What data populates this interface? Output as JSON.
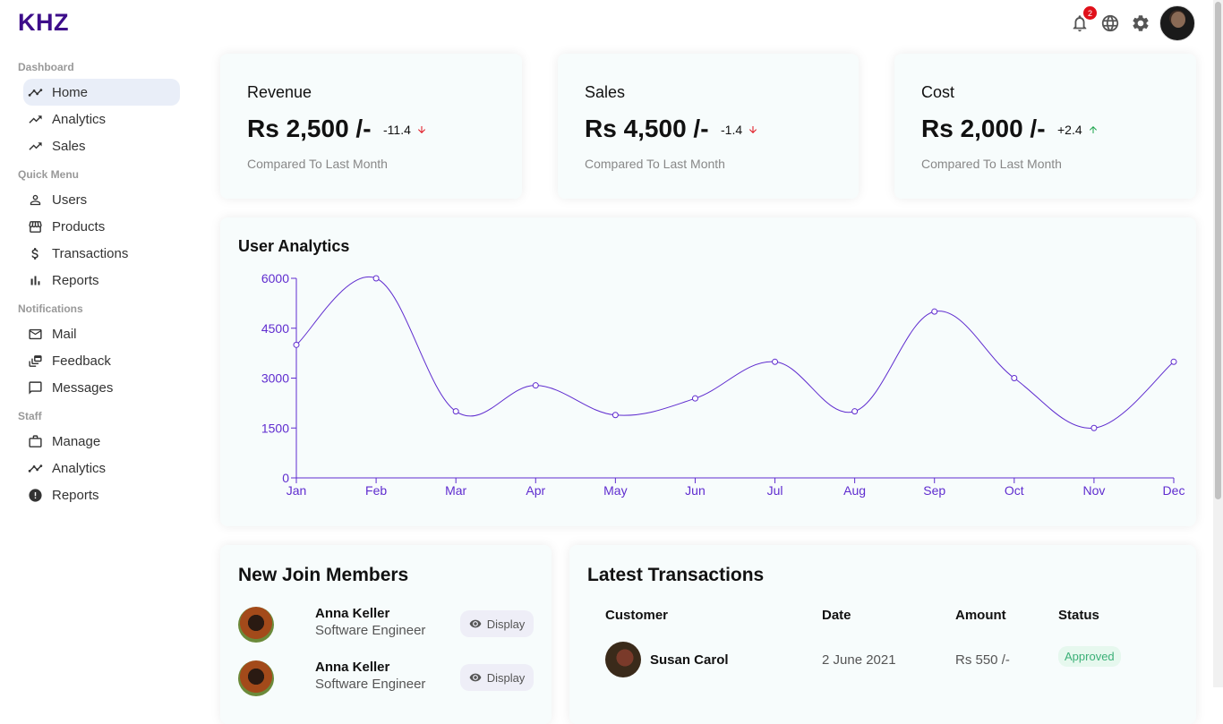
{
  "app": {
    "logo": "KHZ",
    "notification_count": "2"
  },
  "sidebar": {
    "sections": [
      {
        "title": "Dashboard",
        "items": [
          {
            "label": "Home",
            "icon": "timeline-icon",
            "active": true
          },
          {
            "label": "Analytics",
            "icon": "trending-up-icon"
          },
          {
            "label": "Sales",
            "icon": "trending-up-icon"
          }
        ]
      },
      {
        "title": "Quick Menu",
        "items": [
          {
            "label": "Users",
            "icon": "person-icon"
          },
          {
            "label": "Products",
            "icon": "storefront-icon"
          },
          {
            "label": "Transactions",
            "icon": "dollar-icon"
          },
          {
            "label": "Reports",
            "icon": "bar-chart-icon"
          }
        ]
      },
      {
        "title": "Notifications",
        "items": [
          {
            "label": "Mail",
            "icon": "mail-icon"
          },
          {
            "label": "Feedback",
            "icon": "dynamic-feed-icon"
          },
          {
            "label": "Messages",
            "icon": "chat-bubble-icon"
          }
        ]
      },
      {
        "title": "Staff",
        "items": [
          {
            "label": "Manage",
            "icon": "work-icon"
          },
          {
            "label": "Analytics",
            "icon": "timeline-icon"
          },
          {
            "label": "Reports",
            "icon": "report-icon"
          }
        ]
      }
    ]
  },
  "kpis": [
    {
      "title": "Revenue",
      "value": "Rs 2,500 /-",
      "rate": "-11.4",
      "trend": "down",
      "sub": "Compared To Last Month"
    },
    {
      "title": "Sales",
      "value": "Rs 4,500 /-",
      "rate": "-1.4",
      "trend": "down",
      "sub": "Compared To Last Month"
    },
    {
      "title": "Cost",
      "value": "Rs 2,000 /-",
      "rate": "+2.4",
      "trend": "up",
      "sub": "Compared To Last Month"
    }
  ],
  "colors": {
    "accent": "#5f2ccf",
    "down": "#e0101a",
    "up": "#1aa34a",
    "logo": "#3d0d8a"
  },
  "chart_data": {
    "type": "line",
    "title": "User Analytics",
    "categories": [
      "Jan",
      "Feb",
      "Mar",
      "Apr",
      "May",
      "Jun",
      "Jul",
      "Aug",
      "Sep",
      "Oct",
      "Nov",
      "Dec"
    ],
    "series": [
      {
        "values": [
          4000,
          6000,
          2000,
          2780,
          1890,
          2390,
          3490,
          2000,
          5000,
          3000,
          1500,
          3490
        ]
      }
    ],
    "yticks": [
      0,
      1500,
      3000,
      4500,
      6000
    ],
    "ylim": [
      0,
      6000
    ],
    "grid": false,
    "smooth": true
  },
  "members": {
    "title": "New Join Members",
    "button_label": "Display",
    "items": [
      {
        "name": "Anna Keller",
        "job": "Software Engineer"
      },
      {
        "name": "Anna Keller",
        "job": "Software Engineer"
      }
    ]
  },
  "transactions": {
    "title": "Latest Transactions",
    "headers": [
      "Customer",
      "Date",
      "Amount",
      "Status"
    ],
    "rows": [
      {
        "customer": "Susan Carol",
        "date": "2 June 2021",
        "amount": "Rs 550 /-",
        "status": "Approved"
      }
    ]
  }
}
